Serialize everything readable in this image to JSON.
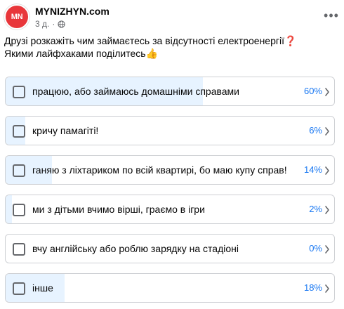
{
  "post": {
    "avatar_text": "MN",
    "page_name": "MYNIZHYN.com",
    "time": "3 д.",
    "text_line1": "Друзі розкажіть чим займаєтесь за відсутності електроенергії❓",
    "text_line2": "Якими лайфхаками поділитесь👍"
  },
  "poll": {
    "options": [
      {
        "label": "працюю, або займаюсь домашніми справами",
        "percent_text": "60%",
        "percent": 60
      },
      {
        "label": "кричу памагіті!",
        "percent_text": "6%",
        "percent": 6
      },
      {
        "label": "ганяю з ліхтариком по всій квартирі, бо маю купу справ!",
        "percent_text": "14%",
        "percent": 14
      },
      {
        "label": "ми з дітьми вчимо вірші, граємо в ігри",
        "percent_text": "2%",
        "percent": 2
      },
      {
        "label": "вчу англійську або роблю зарядку на стадіоні",
        "percent_text": "0%",
        "percent": 0
      },
      {
        "label": "інше",
        "percent_text": "18%",
        "percent": 18
      }
    ]
  },
  "colors": {
    "accent": "#1877f2",
    "fill": "#e7f3ff",
    "avatar_bg": "#e8363a"
  },
  "icons": {
    "globe": "globe-icon",
    "more": "more-options-icon",
    "chevron": "chevron-right-icon"
  }
}
